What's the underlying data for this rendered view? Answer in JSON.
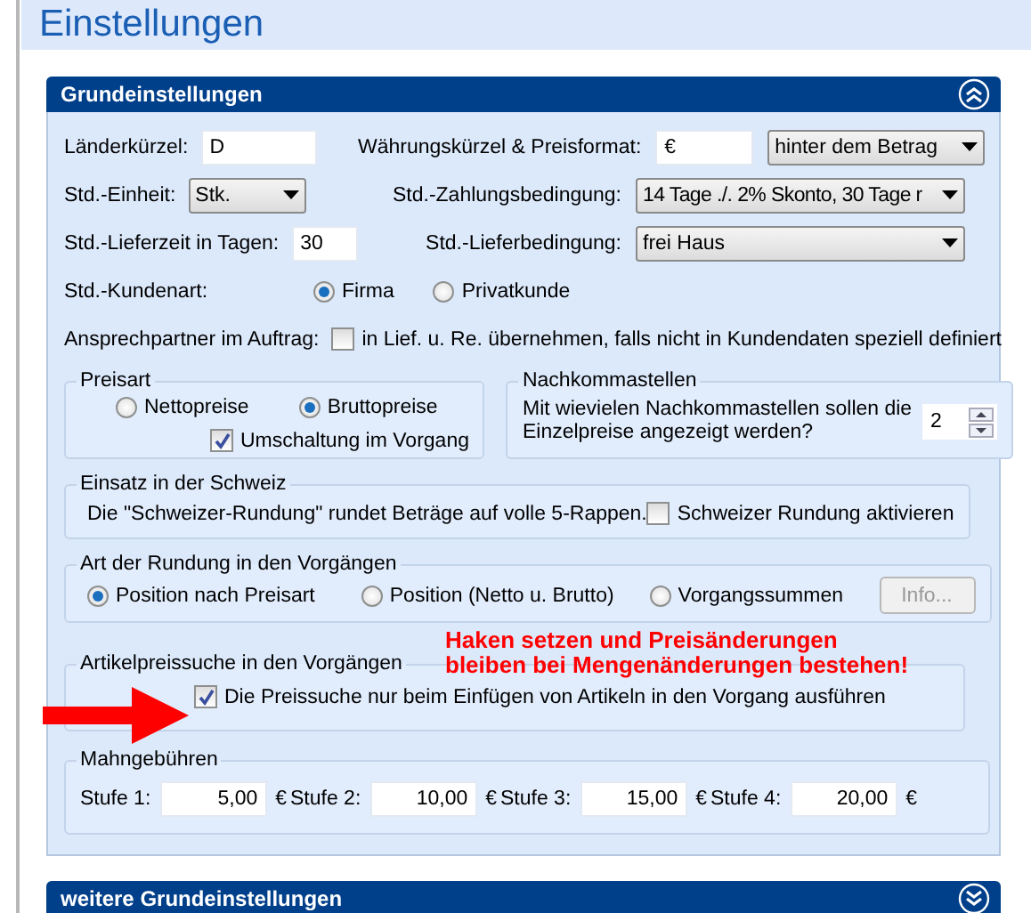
{
  "title": "Einstellungen",
  "panel": {
    "title": "Grundeinstellungen",
    "expanded": true,
    "row1": {
      "label": "Länderkürzel:",
      "value": "D",
      "label2": "Währungskürzel & Preisformat:",
      "currency": "€",
      "format": "hinter dem Betrag"
    },
    "row2": {
      "label": "Std.-Einheit:",
      "unit": "Stk.",
      "label2": "Std.-Zahlungsbedingung:",
      "payment": "14 Tage ./. 2% Skonto, 30 Tage r"
    },
    "row3": {
      "label": "Std.-Lieferzeit in Tagen:",
      "value": "30",
      "label2": "Std.-Lieferbedingung:",
      "delivery": "frei Haus"
    },
    "customer_type": {
      "label": "Std.-Kundenart:",
      "options": [
        {
          "label": "Firma",
          "selected": true
        },
        {
          "label": "Privatkunde",
          "selected": false
        }
      ]
    },
    "contact": {
      "label": "Ansprechpartner im Auftrag:",
      "checkbox": {
        "label": "in Lief. u. Re. übernehmen, falls nicht in Kundendaten speziell definiert",
        "checked": false
      }
    },
    "price_type": {
      "title": "Preisart",
      "options": [
        {
          "label": "Nettopreise",
          "selected": false
        },
        {
          "label": "Bruttopreise",
          "selected": true
        }
      ],
      "checkbox": {
        "label": "Umschaltung im Vorgang",
        "checked": true
      }
    },
    "decimals": {
      "title": "Nachkommastellen",
      "text": "Mit wievielen Nachkommastellen sollen die Einzelpreise angezeigt werden?",
      "value": "2"
    },
    "swiss": {
      "title": "Einsatz in der Schweiz",
      "text": "Die \"Schweizer-Rundung\"  rundet Beträge auf volle 5-Rappen.",
      "checkbox": {
        "label": "Schweizer Rundung aktivieren",
        "checked": false
      }
    },
    "rounding": {
      "title": "Art der Rundung in den Vorgängen",
      "options": [
        {
          "label": "Position nach Preisart",
          "selected": true
        },
        {
          "label": "Position (Netto u. Brutto)",
          "selected": false
        },
        {
          "label": "Vorgangssummen",
          "selected": false
        }
      ],
      "button": {
        "label": "Info...",
        "disabled": true
      }
    },
    "price_search": {
      "title": "Artikelpreissuche in den Vorgängen",
      "checkbox": {
        "label": "Die Preissuche nur beim Einfügen von Artikeln in den Vorgang ausführen",
        "checked": true
      }
    },
    "fees": {
      "title": "Mahngebühren",
      "items": [
        {
          "label": "Stufe 1:",
          "value": "5,00",
          "unit": "€"
        },
        {
          "label": "Stufe 2:",
          "value": "10,00",
          "unit": "€"
        },
        {
          "label": "Stufe 3:",
          "value": "15,00",
          "unit": "€"
        },
        {
          "label": "Stufe 4:",
          "value": "20,00",
          "unit": "€"
        }
      ]
    }
  },
  "annotation": {
    "lines": [
      "Haken setzen und Preisänderungen",
      "bleiben bei Mengenänderungen bestehen!"
    ]
  },
  "panel2": {
    "title": "weitere Grundeinstellungen",
    "expanded": false
  }
}
